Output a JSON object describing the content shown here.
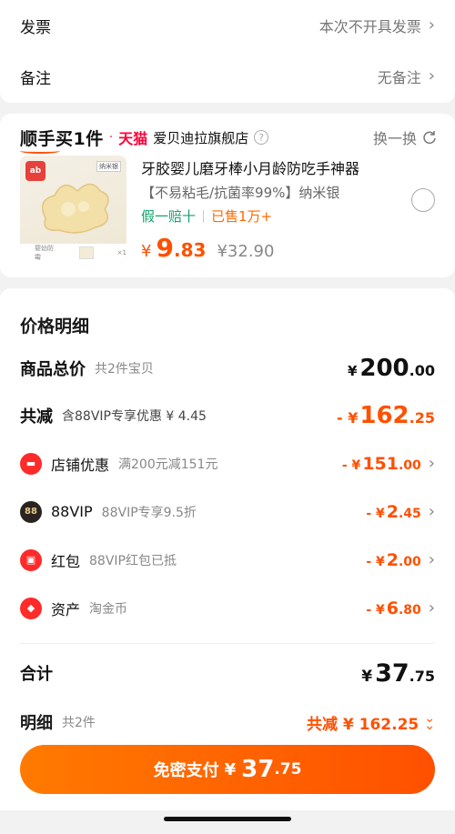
{
  "invoice": {
    "label": "发票",
    "value": "本次不开具发票"
  },
  "remark": {
    "label": "备注",
    "value": "无备注"
  },
  "promo": {
    "title": "顺手买1件",
    "dot": "·",
    "mall": "天猫",
    "store": "爱贝迪拉旗舰店",
    "help": "?",
    "swap": "换一换",
    "thumb_brand": "ab",
    "thumb_tag": "纳米银",
    "thumb_caption": "婴幼防霉",
    "thumb_mini_count": "×1",
    "product": {
      "name": "牙胶婴儿磨牙棒小月龄防吃手神器",
      "features": "【不易粘毛/抗菌率99%】纳米银",
      "guarantee": "假一赔十",
      "sold": "已售1万+",
      "currency": "¥",
      "price_int": "9",
      "price_dec": ".83",
      "orig_price": "¥32.90"
    }
  },
  "detail": {
    "title": "价格明细",
    "goods_total": {
      "label": "商品总价",
      "sub": "共2件宝贝",
      "cur": "¥",
      "int": "200",
      "dec": ".00"
    },
    "reduce": {
      "label": "共减",
      "sub": "含88VIP专享优惠 ¥ 4.45",
      "pre": "- ¥",
      "int": "162",
      "dec": ".25"
    },
    "items": [
      {
        "icon": "store-coupon-icon",
        "glyph": "▬",
        "label": "店铺优惠",
        "sub": "满200元减151元",
        "pre": "- ¥",
        "int": "151",
        "dec": ".00"
      },
      {
        "icon": "vip88-icon",
        "glyph": "88",
        "label": "88VIP",
        "sub": "88VIP专享9.5折",
        "pre": "- ¥",
        "int": "2",
        "dec": ".45"
      },
      {
        "icon": "red-packet-icon",
        "glyph": "▣",
        "label": "红包",
        "sub": "88VIP红包已抵",
        "pre": "- ¥",
        "int": "2",
        "dec": ".00"
      },
      {
        "icon": "asset-coin-icon",
        "glyph": "◆",
        "label": "资产",
        "sub": "淘金币",
        "pre": "- ¥",
        "int": "6",
        "dec": ".80"
      }
    ],
    "total": {
      "label": "合计",
      "cur": "¥",
      "int": "37",
      "dec": ".75"
    },
    "breakdown": {
      "label": "明细",
      "count": "共2件",
      "summary": "共减 ¥ 162.25"
    }
  },
  "pay_button": {
    "label": "免密支付",
    "cur": "¥",
    "int": "37",
    "dec": ".75"
  },
  "colors": {
    "accent": "#ff5000",
    "green": "#13a36b",
    "tmall": "#ff0036"
  }
}
